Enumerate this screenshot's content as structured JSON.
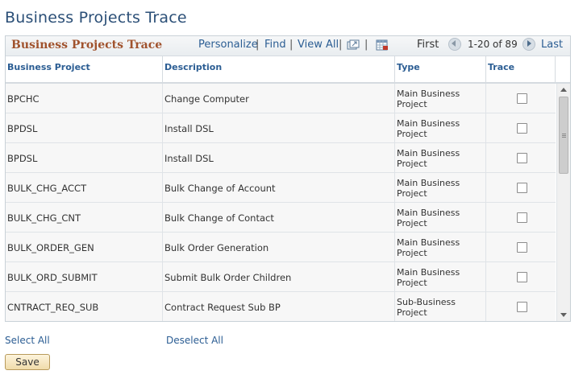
{
  "page": {
    "title": "Business Projects Trace"
  },
  "grid": {
    "title": "Business Projects Trace",
    "nav": {
      "personalize": "Personalize",
      "find": "Find",
      "view_all": "View All",
      "separator": "|",
      "first": "First",
      "range": "1-20 of 89",
      "last": "Last"
    },
    "icons": {
      "zoom": "new-window-icon",
      "download": "download-excel-icon",
      "prev": "previous-arrow-icon",
      "next": "next-arrow-icon"
    },
    "columns": [
      "Business Project",
      "Description",
      "Type",
      "Trace"
    ],
    "rows": [
      {
        "project": "BPCHC",
        "description": "Change Computer",
        "type": "Main Business Project",
        "trace": false
      },
      {
        "project": "BPDSL",
        "description": "Install DSL",
        "type": "Main Business Project",
        "trace": false
      },
      {
        "project": "BPDSL",
        "description": "Install DSL",
        "type": "Main Business Project",
        "trace": false
      },
      {
        "project": "BULK_CHG_ACCT",
        "description": "Bulk Change of Account",
        "type": "Main Business Project",
        "trace": false
      },
      {
        "project": "BULK_CHG_CNT",
        "description": "Bulk Change of Contact",
        "type": "Main Business Project",
        "trace": false
      },
      {
        "project": "BULK_ORDER_GEN",
        "description": "Bulk Order Generation",
        "type": "Main Business Project",
        "trace": false
      },
      {
        "project": "BULK_ORD_SUBMIT",
        "description": "Submit Bulk Order Children",
        "type": "Main Business Project",
        "trace": false
      },
      {
        "project": "CNTRACT_REQ_SUB",
        "description": "Contract Request Sub BP",
        "type": "Sub-Business Project",
        "trace": false
      }
    ]
  },
  "actions": {
    "select_all": "Select All",
    "deselect_all": "Deselect All",
    "save": "Save"
  },
  "colors": {
    "title": "#2b4f77",
    "grid_title": "#a0522d",
    "link": "#2b5d93"
  }
}
